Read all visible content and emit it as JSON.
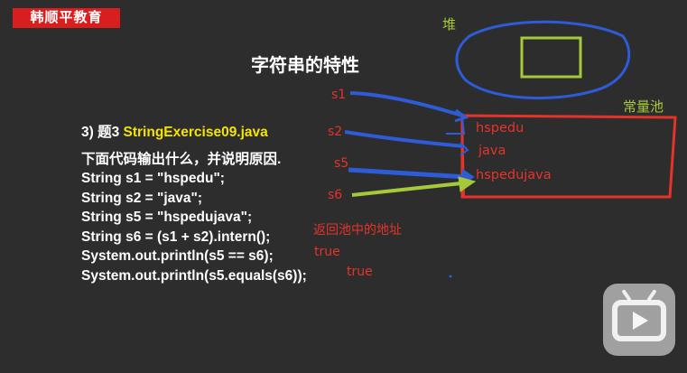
{
  "brand": {
    "label": "韩顺平教育"
  },
  "slide": {
    "title": "字符串的特性",
    "question": {
      "prefix": "3) 题3 ",
      "name": "StringExercise09.java"
    },
    "prompt": "下面代码输出什么，并说明原因.",
    "code_lines": [
      "String s1 = \"hspedu\";",
      "String s2 = \"java\";",
      "String s5 = \"hspedujava\";",
      "String s6 = (s1 + s2).intern();",
      "System.out.println(s5 == s6);",
      "System.out.println(s5.equals(s6));"
    ]
  },
  "annotations": {
    "heap_label": "堆",
    "pool_label": "常量池",
    "refs": [
      "s1",
      "s2",
      "s5",
      "s6"
    ],
    "pool_items": [
      "hspedu",
      "java",
      "hspedujava"
    ],
    "intern_note": "返回池中的地址",
    "result_1": "true",
    "result_2": "true"
  },
  "colors": {
    "brand_bg": "#d81e1e",
    "highlight": "#f5e400",
    "red_ink": "#e6332a",
    "green_ink": "#a6c93a",
    "blue_ink": "#2e5bd6"
  },
  "overlay": {
    "icon": "bilibili-play-icon"
  }
}
